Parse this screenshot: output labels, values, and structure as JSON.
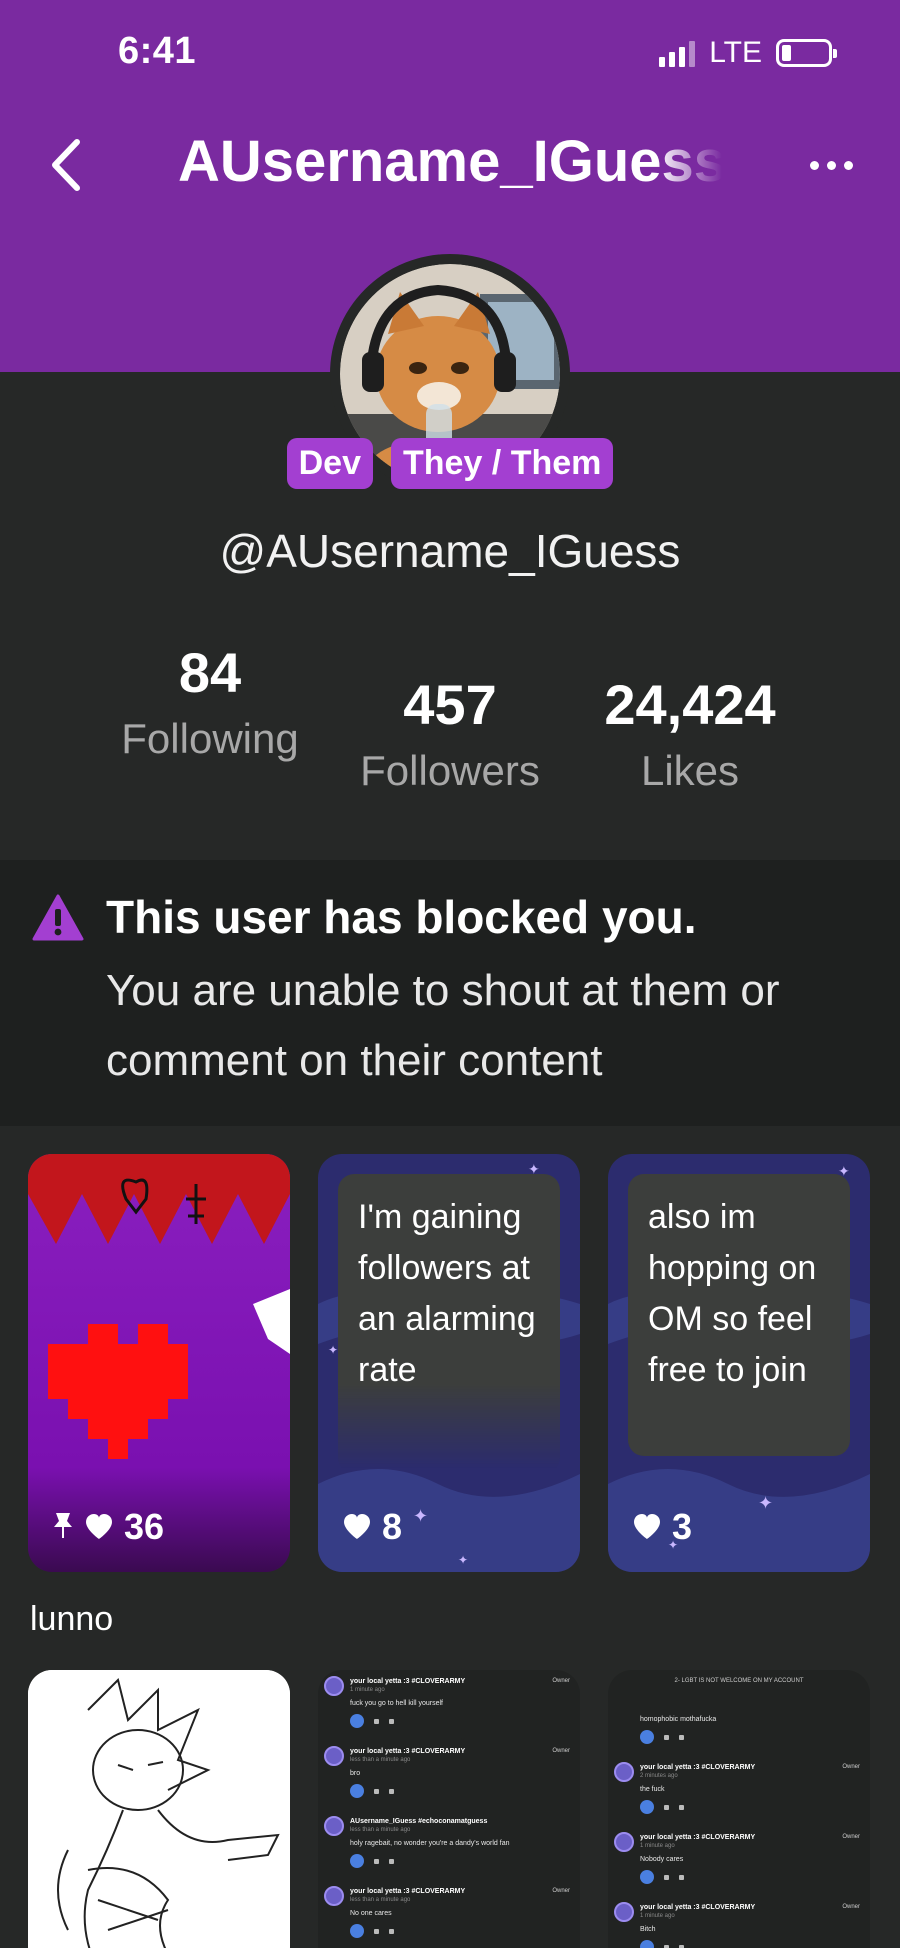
{
  "status_bar": {
    "time": "6:41",
    "network": "LTE"
  },
  "header": {
    "title": "AUsername_IGuess"
  },
  "profile": {
    "badges": [
      "Dev",
      "They / Them"
    ],
    "handle": "@AUsername_IGuess",
    "stats": {
      "following": {
        "value": "84",
        "label": "Following"
      },
      "followers": {
        "value": "457",
        "label": "Followers"
      },
      "likes": {
        "value": "24,424",
        "label": "Likes"
      }
    }
  },
  "blocked_notice": {
    "title": "This user has blocked you.",
    "text": "You are unable to shout at them or comment on their content"
  },
  "posts": [
    {
      "likes": "36",
      "pinned": true
    },
    {
      "text": "I'm gaining followers at an alarming rate",
      "likes": "8"
    },
    {
      "text": "also im hopping on OM so feel free to join",
      "likes": "3"
    }
  ],
  "posts_caption": "lunno",
  "screenshot_post_a": {
    "rows": [
      {
        "name": "your local yetta :3 #CLOVERARMY",
        "time": "1 minute ago",
        "msg": "fuck you go to hell kill yourself",
        "owner": "Owner"
      },
      {
        "name": "your local yetta :3 #CLOVERARMY",
        "time": "less than a minute ago",
        "msg": "bro",
        "owner": "Owner"
      },
      {
        "name": "AUsername_IGuess #echoconamatguess",
        "time": "less than a minute ago",
        "msg": "holy ragebait, no wonder you're a dandy's world fan",
        "owner": ""
      },
      {
        "name": "your local yetta :3 #CLOVERARMY",
        "time": "less than a minute ago",
        "msg": "No one cares",
        "owner": "Owner"
      }
    ]
  },
  "screenshot_post_b": {
    "header": "2- LGBT IS NOT WELCOME ON MY ACCOUNT",
    "rows": [
      {
        "name": "",
        "time": "",
        "msg": "homophobic mothafucka",
        "owner": ""
      },
      {
        "name": "your local yetta :3 #CLOVERARMY",
        "time": "2 minutes ago",
        "msg": "the fuck",
        "owner": "Owner"
      },
      {
        "name": "your local yetta :3 #CLOVERARMY",
        "time": "1 minute ago",
        "msg": "Nobody cares",
        "owner": "Owner"
      },
      {
        "name": "your local yetta :3 #CLOVERARMY",
        "time": "1 minute ago",
        "msg": "Bitch",
        "owner": "Owner"
      }
    ]
  },
  "colors": {
    "brand_purple": "#7a2aa0",
    "badge_purple": "#a33fd1",
    "background": "#262827"
  }
}
